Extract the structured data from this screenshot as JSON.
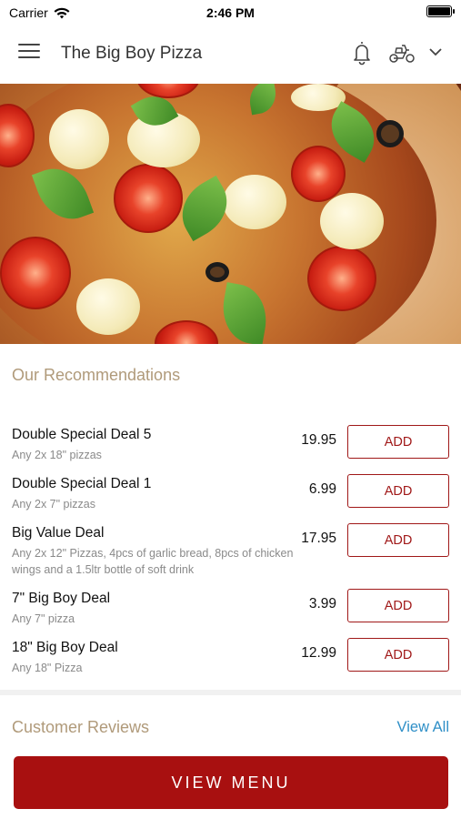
{
  "status_bar": {
    "carrier": "Carrier",
    "time": "2:46 PM"
  },
  "app_bar": {
    "title": "The Big Boy Pizza"
  },
  "recommendations": {
    "heading": "Our Recommendations",
    "items": [
      {
        "name": "Double Special Deal 5",
        "description": "Any 2x 18\" pizzas",
        "price": "19.95",
        "button": "ADD"
      },
      {
        "name": "Double Special Deal 1",
        "description": "Any 2x 7\" pizzas",
        "price": "6.99",
        "button": "ADD"
      },
      {
        "name": "Big Value Deal",
        "description": "Any 2x 12\" Pizzas, 4pcs of garlic bread, 8pcs of chicken wings and a 1.5ltr bottle of soft drink",
        "price": "17.95",
        "button": "ADD"
      },
      {
        "name": "7\" Big Boy Deal",
        "description": "Any 7\" pizza",
        "price": "3.99",
        "button": "ADD"
      },
      {
        "name": "18\" Big Boy Deal",
        "description": "Any 18\" Pizza",
        "price": "12.99",
        "button": "ADD"
      }
    ]
  },
  "reviews": {
    "heading": "Customer Reviews",
    "view_all": "View All"
  },
  "cta": {
    "label": "VIEW MENU"
  },
  "colors": {
    "accent": "#a81010",
    "section_heading": "#b09a7a",
    "link": "#2f8fc7"
  }
}
